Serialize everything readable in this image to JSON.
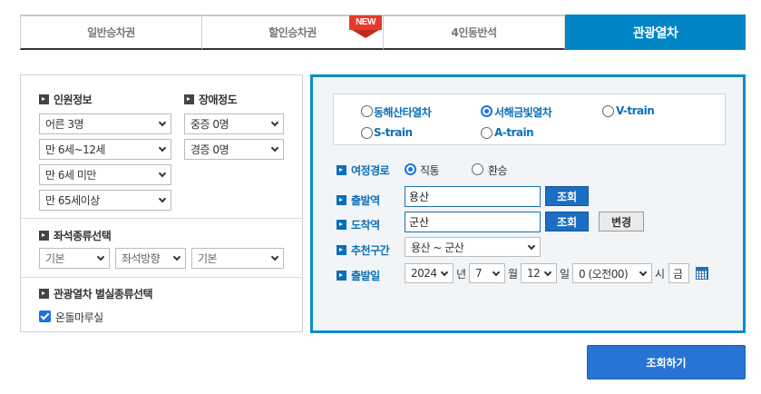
{
  "tabs": [
    {
      "label": "일반승차권"
    },
    {
      "label": "할인승차권",
      "badge": "NEW"
    },
    {
      "label": "4인동반석"
    },
    {
      "label": "관광열차"
    }
  ],
  "passengers": {
    "title": "인원정보",
    "adult": "어른 3명",
    "child": "만 6세~12세",
    "infant": "만 6세 미만",
    "senior": "만 65세이상"
  },
  "disability": {
    "title": "장애정도",
    "severe": "중증 0명",
    "mild": "경증 0명"
  },
  "seat_type": {
    "title": "좌석종류선택",
    "options": [
      "기본",
      "좌석방향",
      "기본"
    ]
  },
  "tour_car": {
    "title": "관광열차 별실종류선택",
    "checkbox_label": "온돌마루실",
    "checked": true
  },
  "trains": {
    "options": [
      "동해산타열차",
      "서해금빛열차",
      "V-train",
      "S-train",
      "A-train"
    ],
    "selected": "서해금빛열차"
  },
  "trip": {
    "route_label": "여정경로",
    "direct": "직통",
    "transfer": "환승",
    "selected": "직통",
    "departure_label": "출발역",
    "departure_value": "용산",
    "arrival_label": "도착역",
    "arrival_value": "군산",
    "lookup_label": "조회",
    "swap_label": "변경",
    "recommend_label": "추천구간",
    "recommend_value": "용산 ~ 군산",
    "date_label": "출발일",
    "year": "2024",
    "year_unit": "년",
    "month": "7",
    "month_unit": "월",
    "day": "12",
    "day_unit": "일",
    "hour": "0 (오전00)",
    "hour_unit": "시",
    "weekday": "금"
  },
  "search_button": "조회하기",
  "colors": {
    "accent": "#0085c6",
    "label_blue": "#0b6fb8",
    "button_blue": "#2874d4",
    "badge_red": "#e63a2a"
  }
}
